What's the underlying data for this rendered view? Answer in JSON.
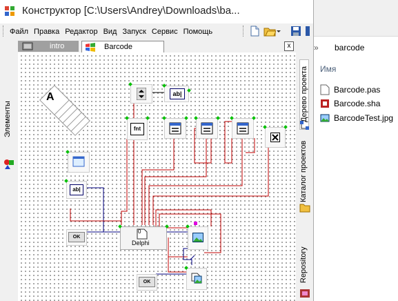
{
  "window": {
    "title": "Конструктор [C:\\Users\\Andrey\\Downloads\\ba..."
  },
  "menu": {
    "items": [
      "Файл",
      "Правка",
      "Редактор",
      "Вид",
      "Запуск",
      "Сервис",
      "Помощь"
    ]
  },
  "left_panel": {
    "tab_label": "Элементы"
  },
  "tabs": {
    "items": [
      {
        "label": "intro"
      },
      {
        "label": "Barcode"
      }
    ],
    "close": "x"
  },
  "right_panel": {
    "tabs": [
      "Дерево проекта",
      "Каталог проектов",
      "Repository"
    ]
  },
  "explorer": {
    "crumb_sep": "»",
    "crumb": "barcode",
    "column_header": "Имя",
    "files": [
      "Barcode.pas",
      "Barcode.sha",
      "BarcodeTest.jpg"
    ]
  },
  "canvas": {
    "nodes": {
      "label_a": "A",
      "fnt_label": "fnt",
      "edit_label": "ab|",
      "ok_label": "OK",
      "delphi_label": "Delphi",
      "delphi_num": "0"
    }
  },
  "colors": {
    "wire_red": "#c00000",
    "wire_blue": "#000080",
    "pin_green": "#00c000",
    "pin_yellow": "#e8e000",
    "pin_cyan": "#40c0e0",
    "pin_magenta": "#e000e0"
  }
}
